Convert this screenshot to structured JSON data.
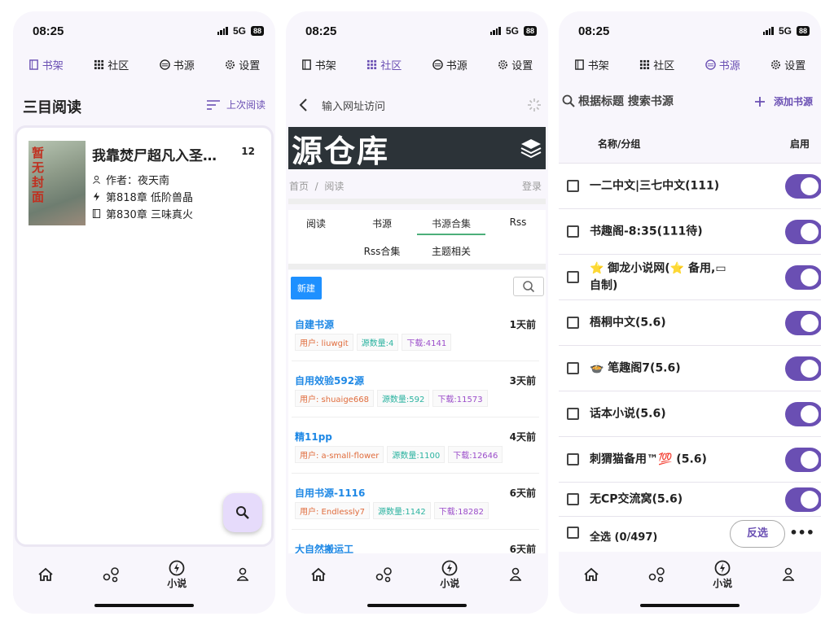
{
  "status": {
    "time": "08:25",
    "network": "5G",
    "battery": "88"
  },
  "topnav": [
    "书架",
    "社区",
    "书源",
    "设置"
  ],
  "bottomnav": {
    "novel": "小说"
  },
  "bookshelf": {
    "title": "三目阅读",
    "last_read": "上次阅读",
    "book": {
      "cover_text": "暂无封面",
      "title": "我靠焚尸超凡入圣…",
      "count": "12",
      "author": "作者：夜天南",
      "latest": "第818章 低阶兽晶",
      "current": "第830章 三味真火"
    }
  },
  "repo": {
    "url_placeholder": "输入网址访问",
    "banner": "源仓库",
    "crumb_home": "首页",
    "crumb_sep": "/",
    "crumb_read": "阅读",
    "login": "登录",
    "tabs": [
      "阅读",
      "书源",
      "书源合集",
      "Rss",
      "Rss合集",
      "主题相关"
    ],
    "new_label": "新建",
    "items": [
      {
        "name": "自建书源",
        "time": "1天前",
        "user": "用户: liuwgit",
        "count": "源数量:4",
        "downloads": "下载:4141"
      },
      {
        "name": "自用效验592源",
        "time": "3天前",
        "user": "用户: shuaige668",
        "count": "源数量:592",
        "downloads": "下载:11573"
      },
      {
        "name": "精11pp",
        "time": "4天前",
        "user": "用户: a-small-flower",
        "count": "源数量:1100",
        "downloads": "下载:12646"
      },
      {
        "name": "自用书源-1116",
        "time": "6天前",
        "user": "用户: Endlessly7",
        "count": "源数量:1142",
        "downloads": "下载:18282"
      },
      {
        "name": "大自然搬运工",
        "time": "6天前",
        "user": "",
        "count": "",
        "downloads": ""
      }
    ]
  },
  "sources": {
    "search_placeholder": "根据标题 搜索书源",
    "add_label": "添加书源",
    "col_name": "名称/分组",
    "col_enable": "启用",
    "items": [
      {
        "name": "一二中文|三七中文(111)"
      },
      {
        "name": "书趣阁-8:35(111待)"
      },
      {
        "name": "⭐ 御龙小说网(⭐ 备用,▭ 自制)"
      },
      {
        "name": "梧桐中文(5.6)"
      },
      {
        "name": "🍲 笔趣阁7(5.6)"
      },
      {
        "name": "话本小说(5.6)"
      },
      {
        "name": "刺猬猫备用™💯 (5.6)"
      },
      {
        "name": "无CP交流窝(5.6)"
      }
    ],
    "select_all": "全选 (0/497)",
    "invert": "反选",
    "more": "•••"
  },
  "colors": {
    "accent": "#6a4fb3",
    "link": "#1e88e5"
  }
}
